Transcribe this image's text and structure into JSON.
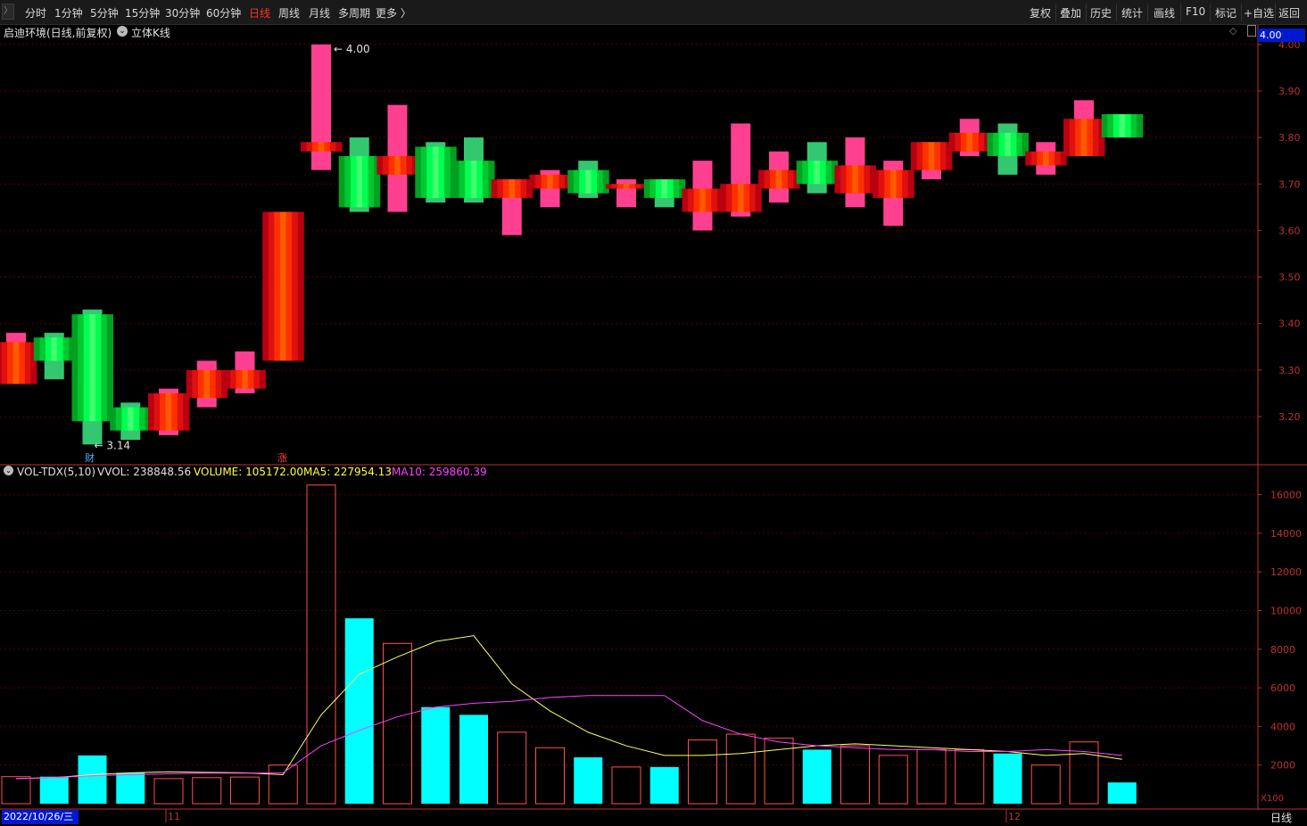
{
  "toolbar": {
    "periods": [
      "分时",
      "1分钟",
      "5分钟",
      "15分钟",
      "30分钟",
      "60分钟",
      "日线",
      "周线",
      "月线",
      "多周期",
      "更多 〉"
    ],
    "active_period": "日线",
    "right_buttons": [
      "复权",
      "叠加",
      "历史",
      "统计",
      "画线",
      "F10",
      "标记",
      "+自选",
      "返回"
    ]
  },
  "info": {
    "stock_title": "启迪环境(日线,前复权)",
    "chart_type": "立体K线",
    "price_tag": "4.00"
  },
  "main_chart": {
    "price_ticks": [
      "3.20",
      "3.30",
      "3.40",
      "3.50",
      "3.60",
      "3.70",
      "3.80",
      "3.90",
      "4.00"
    ],
    "high_label": "4.00",
    "low_label": "3.14",
    "marker_cai": "财",
    "marker_zhang": "涨"
  },
  "volume": {
    "indicator": "VOL-TDX(5,10)",
    "vvol": "VVOL: 238848.56",
    "volume": "VOLUME: 105172.00",
    "ma5": "MA5: 227954.13",
    "ma10": "MA10: 259860.39",
    "ticks": [
      "2000",
      "4000",
      "6000",
      "8000",
      "10000",
      "12000",
      "14000",
      "16000"
    ],
    "unit": "X100"
  },
  "axis": {
    "start_date": "2022/10/26/三",
    "month_11": "11",
    "month_12": "12",
    "period_label": "日线"
  },
  "colors": {
    "up": "#ff2a2a",
    "down": "#00e040",
    "cyan": "#00ffff",
    "ma5": "#ffff66",
    "ma10": "#ff40ff",
    "grid": "#5a0000",
    "axis": "#c03030"
  },
  "chart_data": {
    "type": "candlestick",
    "x_range": [
      0,
      29
    ],
    "y_range": [
      3.14,
      4.0
    ],
    "volume_range": [
      0,
      16000
    ],
    "candles": [
      {
        "o": 3.27,
        "c": 3.36,
        "h": 3.38,
        "l": 3.27,
        "v": 1400
      },
      {
        "o": 3.37,
        "c": 3.32,
        "h": 3.38,
        "l": 3.28,
        "v": 1400
      },
      {
        "o": 3.42,
        "c": 3.19,
        "h": 3.43,
        "l": 3.14,
        "v": 2500
      },
      {
        "o": 3.22,
        "c": 3.17,
        "h": 3.23,
        "l": 3.15,
        "v": 1600
      },
      {
        "o": 3.17,
        "c": 3.25,
        "h": 3.26,
        "l": 3.16,
        "v": 1300
      },
      {
        "o": 3.24,
        "c": 3.3,
        "h": 3.32,
        "l": 3.22,
        "v": 1350
      },
      {
        "o": 3.26,
        "c": 3.3,
        "h": 3.34,
        "l": 3.25,
        "v": 1380
      },
      {
        "o": 3.32,
        "c": 3.64,
        "h": 3.64,
        "l": 3.32,
        "v": 2000
      },
      {
        "o": 3.77,
        "c": 3.79,
        "h": 4.0,
        "l": 3.73,
        "v": 16500
      },
      {
        "o": 3.76,
        "c": 3.65,
        "h": 3.8,
        "l": 3.64,
        "v": 9600
      },
      {
        "o": 3.72,
        "c": 3.76,
        "h": 3.87,
        "l": 3.64,
        "v": 8300
      },
      {
        "o": 3.78,
        "c": 3.67,
        "h": 3.79,
        "l": 3.66,
        "v": 5000
      },
      {
        "o": 3.75,
        "c": 3.67,
        "h": 3.8,
        "l": 3.66,
        "v": 4600
      },
      {
        "o": 3.67,
        "c": 3.71,
        "h": 3.71,
        "l": 3.59,
        "v": 3700
      },
      {
        "o": 3.69,
        "c": 3.72,
        "h": 3.73,
        "l": 3.65,
        "v": 2900
      },
      {
        "o": 3.73,
        "c": 3.68,
        "h": 3.75,
        "l": 3.67,
        "v": 2400
      },
      {
        "o": 3.69,
        "c": 3.7,
        "h": 3.71,
        "l": 3.65,
        "v": 1900
      },
      {
        "o": 3.71,
        "c": 3.67,
        "h": 3.71,
        "l": 3.65,
        "v": 1900
      },
      {
        "o": 3.64,
        "c": 3.69,
        "h": 3.75,
        "l": 3.6,
        "v": 3300
      },
      {
        "o": 3.64,
        "c": 3.7,
        "h": 3.83,
        "l": 3.63,
        "v": 3600
      },
      {
        "o": 3.69,
        "c": 3.73,
        "h": 3.77,
        "l": 3.66,
        "v": 3400
      },
      {
        "o": 3.75,
        "c": 3.7,
        "h": 3.79,
        "l": 3.68,
        "v": 2800
      },
      {
        "o": 3.68,
        "c": 3.74,
        "h": 3.8,
        "l": 3.65,
        "v": 3000
      },
      {
        "o": 3.67,
        "c": 3.73,
        "h": 3.75,
        "l": 3.61,
        "v": 2500
      },
      {
        "o": 3.73,
        "c": 3.79,
        "h": 3.79,
        "l": 3.71,
        "v": 2800
      },
      {
        "o": 3.77,
        "c": 3.81,
        "h": 3.84,
        "l": 3.76,
        "v": 2800
      },
      {
        "o": 3.81,
        "c": 3.76,
        "h": 3.83,
        "l": 3.72,
        "v": 2600
      },
      {
        "o": 3.74,
        "c": 3.77,
        "h": 3.79,
        "l": 3.72,
        "v": 2000
      },
      {
        "o": 3.76,
        "c": 3.84,
        "h": 3.88,
        "l": 3.76,
        "v": 3200
      },
      {
        "o": 3.85,
        "c": 3.8,
        "h": 3.85,
        "l": 3.8,
        "v": 1100
      }
    ],
    "ma5": [
      1300,
      1350,
      1500,
      1600,
      1650,
      1620,
      1600,
      1500,
      4600,
      6700,
      7600,
      8400,
      8700,
      6200,
      4800,
      3700,
      3000,
      2500,
      2500,
      2600,
      2800,
      3000,
      3100,
      3000,
      2900,
      2800,
      2700,
      2500,
      2600,
      2300
    ],
    "ma10": [
      1300,
      1350,
      1450,
      1500,
      1550,
      1580,
      1580,
      1600,
      3000,
      3800,
      4500,
      5000,
      5200,
      5300,
      5500,
      5600,
      5600,
      5600,
      4300,
      3600,
      3200,
      3000,
      2900,
      2800,
      2800,
      2700,
      2700,
      2800,
      2700,
      2500
    ]
  }
}
